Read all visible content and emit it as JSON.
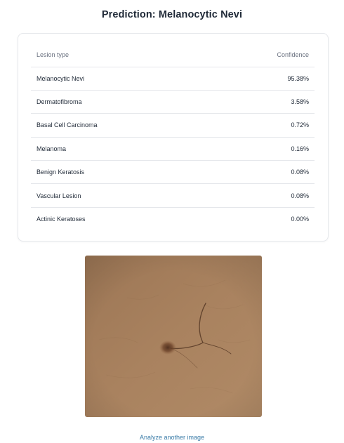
{
  "title": "Prediction: Melanocytic Nevi",
  "table": {
    "headers": {
      "type": "Lesion type",
      "confidence": "Confidence"
    },
    "rows": [
      {
        "type": "Melanocytic Nevi",
        "confidence": "95.38%"
      },
      {
        "type": "Dermatofibroma",
        "confidence": "3.58%"
      },
      {
        "type": "Basal Cell Carcinoma",
        "confidence": "0.72%"
      },
      {
        "type": "Melanoma",
        "confidence": "0.16%"
      },
      {
        "type": "Benign Keratosis",
        "confidence": "0.08%"
      },
      {
        "type": "Vascular Lesion",
        "confidence": "0.08%"
      },
      {
        "type": "Actinic Keratoses",
        "confidence": "0.00%"
      }
    ]
  },
  "image": {
    "skin_color": "#a67f5c",
    "lesion_color": "#5e3a26"
  },
  "action": {
    "label": "Analyze another image"
  },
  "colors": {
    "link": "#3b7ca8",
    "border": "#e5e7eb"
  }
}
